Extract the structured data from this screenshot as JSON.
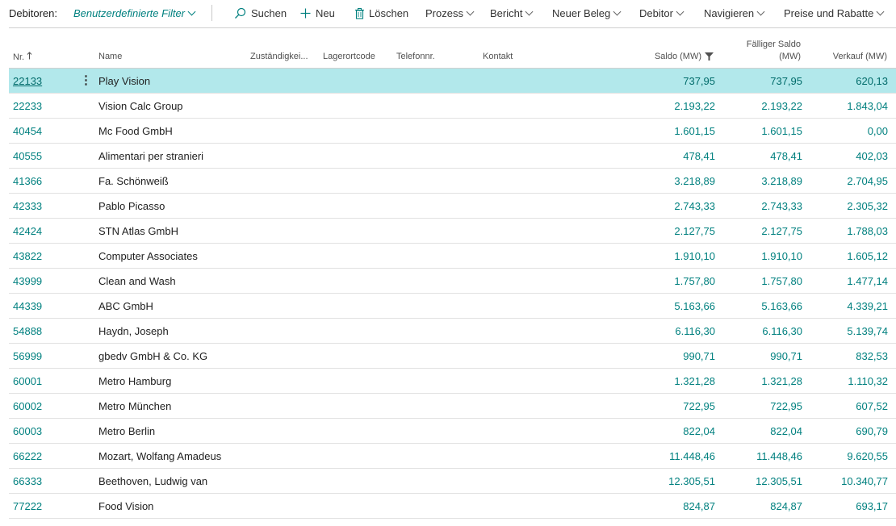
{
  "toolbar": {
    "title": "Debitoren:",
    "filter_label": "Benutzerdefinierte Filter",
    "search": "Suchen",
    "new": "Neu",
    "delete": "Löschen",
    "process": "Prozess",
    "report": "Bericht",
    "new_document": "Neuer Beleg",
    "customer": "Debitor",
    "navigate": "Navigieren",
    "prices": "Preise und Rabatte"
  },
  "columns": {
    "nr": "Nr.",
    "name": "Name",
    "responsibility": "Zuständigkei...",
    "location": "Lagerortcode",
    "phone": "Telefonnr.",
    "contact": "Kontakt",
    "balance": "Saldo (MW)",
    "due_balance_line1": "Fälliger Saldo",
    "due_balance_line2": "(MW)",
    "sales": "Verkauf (MW)"
  },
  "rows": [
    {
      "nr": "22133",
      "name": "Play Vision",
      "saldo": "737,95",
      "faellig": "737,95",
      "verkauf": "620,13",
      "selected": true
    },
    {
      "nr": "22233",
      "name": "Vision Calc Group",
      "saldo": "2.193,22",
      "faellig": "2.193,22",
      "verkauf": "1.843,04"
    },
    {
      "nr": "40454",
      "name": "Mc Food GmbH",
      "saldo": "1.601,15",
      "faellig": "1.601,15",
      "verkauf": "0,00"
    },
    {
      "nr": "40555",
      "name": "Alimentari per stranieri",
      "saldo": "478,41",
      "faellig": "478,41",
      "verkauf": "402,03"
    },
    {
      "nr": "41366",
      "name": "Fa. Schönweiß",
      "saldo": "3.218,89",
      "faellig": "3.218,89",
      "verkauf": "2.704,95"
    },
    {
      "nr": "42333",
      "name": "Pablo Picasso",
      "saldo": "2.743,33",
      "faellig": "2.743,33",
      "verkauf": "2.305,32"
    },
    {
      "nr": "42424",
      "name": "STN Atlas GmbH",
      "saldo": "2.127,75",
      "faellig": "2.127,75",
      "verkauf": "1.788,03"
    },
    {
      "nr": "43822",
      "name": "Computer Associates",
      "saldo": "1.910,10",
      "faellig": "1.910,10",
      "verkauf": "1.605,12"
    },
    {
      "nr": "43999",
      "name": "Clean and Wash",
      "saldo": "1.757,80",
      "faellig": "1.757,80",
      "verkauf": "1.477,14"
    },
    {
      "nr": "44339",
      "name": "ABC GmbH",
      "saldo": "5.163,66",
      "faellig": "5.163,66",
      "verkauf": "4.339,21"
    },
    {
      "nr": "54888",
      "name": "Haydn, Joseph",
      "saldo": "6.116,30",
      "faellig": "6.116,30",
      "verkauf": "5.139,74"
    },
    {
      "nr": "56999",
      "name": "gbedv GmbH & Co. KG",
      "saldo": "990,71",
      "faellig": "990,71",
      "verkauf": "832,53"
    },
    {
      "nr": "60001",
      "name": "Metro Hamburg",
      "saldo": "1.321,28",
      "faellig": "1.321,28",
      "verkauf": "1.110,32"
    },
    {
      "nr": "60002",
      "name": "Metro München",
      "saldo": "722,95",
      "faellig": "722,95",
      "verkauf": "607,52"
    },
    {
      "nr": "60003",
      "name": "Metro Berlin",
      "saldo": "822,04",
      "faellig": "822,04",
      "verkauf": "690,79"
    },
    {
      "nr": "66222",
      "name": "Mozart, Wolfang Amadeus",
      "saldo": "11.448,46",
      "faellig": "11.448,46",
      "verkauf": "9.620,55"
    },
    {
      "nr": "66333",
      "name": "Beethoven, Ludwig van",
      "saldo": "12.305,51",
      "faellig": "12.305,51",
      "verkauf": "10.340,77"
    },
    {
      "nr": "77222",
      "name": "Food Vision",
      "saldo": "824,87",
      "faellig": "824,87",
      "verkauf": "693,17"
    }
  ]
}
